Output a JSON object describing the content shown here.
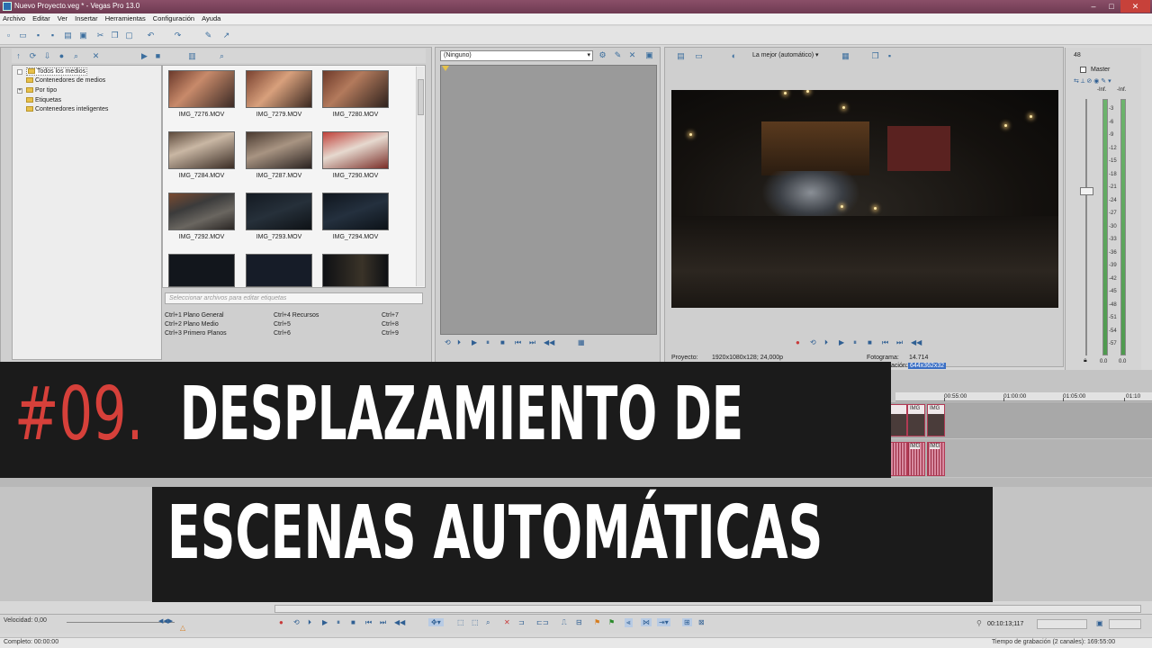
{
  "window": {
    "title": "Nuevo Proyecto.veg * - Vegas Pro 13.0",
    "controls": [
      "–",
      "□",
      "✕"
    ]
  },
  "menu": [
    "Archivo",
    "Editar",
    "Ver",
    "Insertar",
    "Herramientas",
    "Configuración",
    "Ayuda"
  ],
  "explorer": {
    "tree": [
      "Todos los medios",
      "Contenedores de medios",
      "Por tipo",
      "Etiquetas",
      "Contenedores inteligentes"
    ],
    "files": [
      "IMG_7276.MOV",
      "IMG_7279.MOV",
      "IMG_7280.MOV",
      "IMG_7284.MOV",
      "IMG_7287.MOV",
      "IMG_7290.MOV",
      "IMG_7292.MOV",
      "IMG_7293.MOV",
      "IMG_7294.MOV"
    ],
    "tag_placeholder": "Seleccionar archivos para editar etiquetas",
    "shortcuts": [
      "Ctrl+1  Plano General",
      "Ctrl+4  Recursos",
      "Ctrl+7",
      "Ctrl+2  Plano Medio",
      "Ctrl+5",
      "Ctrl+8",
      "Ctrl+3  Primero Planos",
      "Ctrl+6",
      "Ctrl+9"
    ]
  },
  "trimmer": {
    "selected": "(Ninguno)"
  },
  "preview": {
    "quality": "La mejor (automático)",
    "proyecto_label": "Proyecto:",
    "proyecto_value": "1920x1080x128; 24,000p",
    "fotograma_label": "Fotograma:",
    "fotograma_value": "14.714",
    "visualizacion_label": "ación:",
    "visualizacion_value": "644x362x32"
  },
  "master": {
    "label": "Master",
    "level_top": "48",
    "inf_left": "-Inf.",
    "inf_right": "-Inf.",
    "db_ticks": [
      "3",
      "6",
      "9",
      "12",
      "15",
      "18",
      "21",
      "24",
      "27",
      "30",
      "33",
      "36",
      "39",
      "42",
      "45",
      "48",
      "51",
      "54",
      "57"
    ],
    "bottom_left": "0.0",
    "bottom_right": "0.0"
  },
  "timeline": {
    "ruler": [
      "00:55:00",
      "01:00:00",
      "01:05:00",
      "01:10"
    ],
    "clip_name": "IMG"
  },
  "transport": {
    "speed": "Velocidad: 0,00",
    "timecode": "00:10:13;117"
  },
  "status": {
    "left": "Completo: 00:00:00",
    "right": "Tiempo de grabación (2 canales): 169:55:00"
  },
  "overlay": {
    "number": "#09.",
    "line1": "DESPLAZAMIENTO DE",
    "line2": "ESCENAS AUTOMÁTICAS"
  },
  "colors": {
    "titlebar": "#7a4560",
    "overlay_bg": "#1b1b1b",
    "number_accent": "#d6403a",
    "clip_border": "#b23a54",
    "meter": "#5aa55a"
  }
}
